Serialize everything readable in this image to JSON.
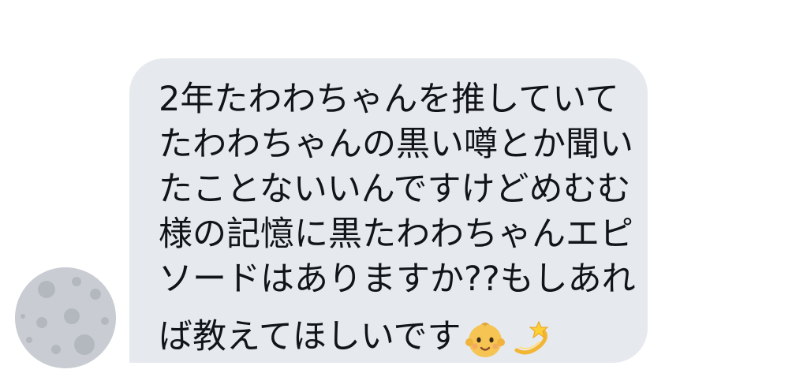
{
  "message": {
    "lines": [
      "2年たわわちゃんを推していて",
      "たわわちゃんの黒い噂とか聞い",
      "たことないいんですけどめむむ",
      "様の記憶に黒たわわちゃんエピ",
      "ソードはありますか??もしあれ",
      "ば教えてほしいです"
    ],
    "emojis": [
      "baby-emoji",
      "dizzy-emoji"
    ]
  },
  "colors": {
    "bubble": "#e6e9ee",
    "text": "#111418",
    "avatar": "#c8ccd2"
  }
}
